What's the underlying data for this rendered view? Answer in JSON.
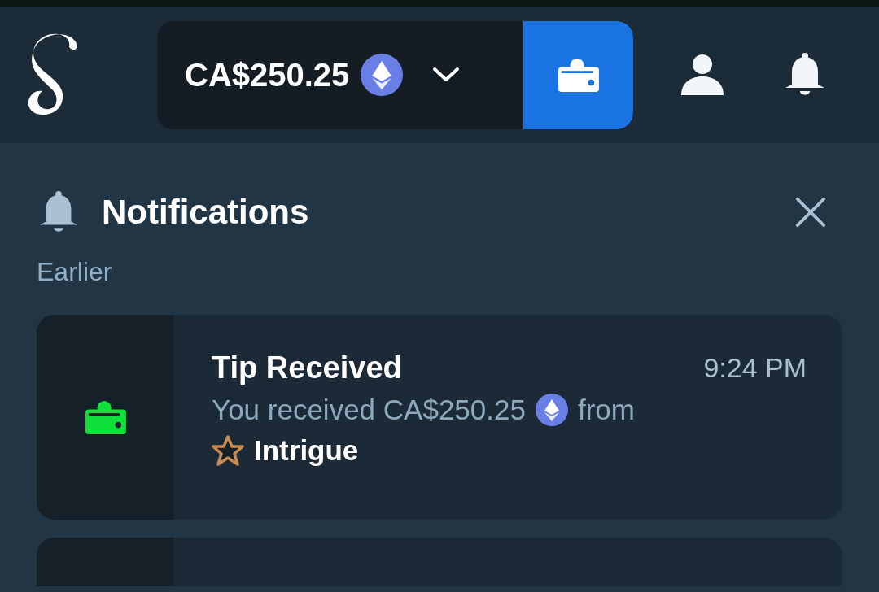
{
  "header": {
    "balance": "CA$250.25"
  },
  "panel": {
    "title": "Notifications",
    "section": "Earlier",
    "notifications": [
      {
        "kind": "tip",
        "title": "Tip Received",
        "time": "9:24 PM",
        "message": "You received CA$250.25",
        "message_end": "from",
        "sender": "Intrigue"
      }
    ]
  }
}
